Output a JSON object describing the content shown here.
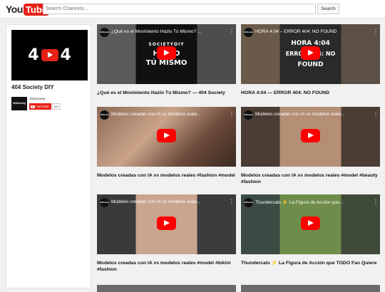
{
  "header": {
    "logo_you": "You",
    "logo_tube": "Tube",
    "search_placeholder": "Search Channels...",
    "search_button": "Search"
  },
  "channel": {
    "art_left": "4",
    "art_right": "4",
    "name": "404 Society DIY",
    "avatar_text": "404Society",
    "handle": "404Society",
    "subscribe_label": "YouTube",
    "sub_count": "391"
  },
  "videos": [
    {
      "overlay_title": "¿Qué es el Movimiento Hazlo Tú Mismo? ...",
      "thumb_text": "SOCIETYDIY\nHAZLO\nTÚ MISMO",
      "title": "¿Qué es el Movimiento Hazlo Tú Mismo? — 404 Society"
    },
    {
      "overlay_title": "HORA 4:04 – ERROR 404: NO FOUND",
      "thumb_text": "HORA 4:04\nERROR 404: NO\nFOUND",
      "title": "HORA 4:04 — ERROR 404: NO FOUND"
    },
    {
      "overlay_title": "Modelos creadas con IA vs modelos reale...",
      "title": "Modelos creadas con IA vs modelos reales #fashion #model"
    },
    {
      "overlay_title": "Modelos creadas con IA vs modelos reale...",
      "title": "Modelos creadas con IA vs modelos reales #model #beauty #fashion"
    },
    {
      "overlay_title": "Modelos creadas con IA vs modelos reale...",
      "title": "Modelos creadas con IA vs modelos reales #model #bikini #fashion"
    },
    {
      "overlay_title": "Thundercats ⚡ La Figura de Acción que...",
      "title": "Thundercats ⚡ La Figura de Acción que TODO Fan Quiere"
    }
  ],
  "colors": {
    "brand_red": "#e62117",
    "play_red": "#ff0000",
    "page_bg": "#f1f1f1"
  }
}
